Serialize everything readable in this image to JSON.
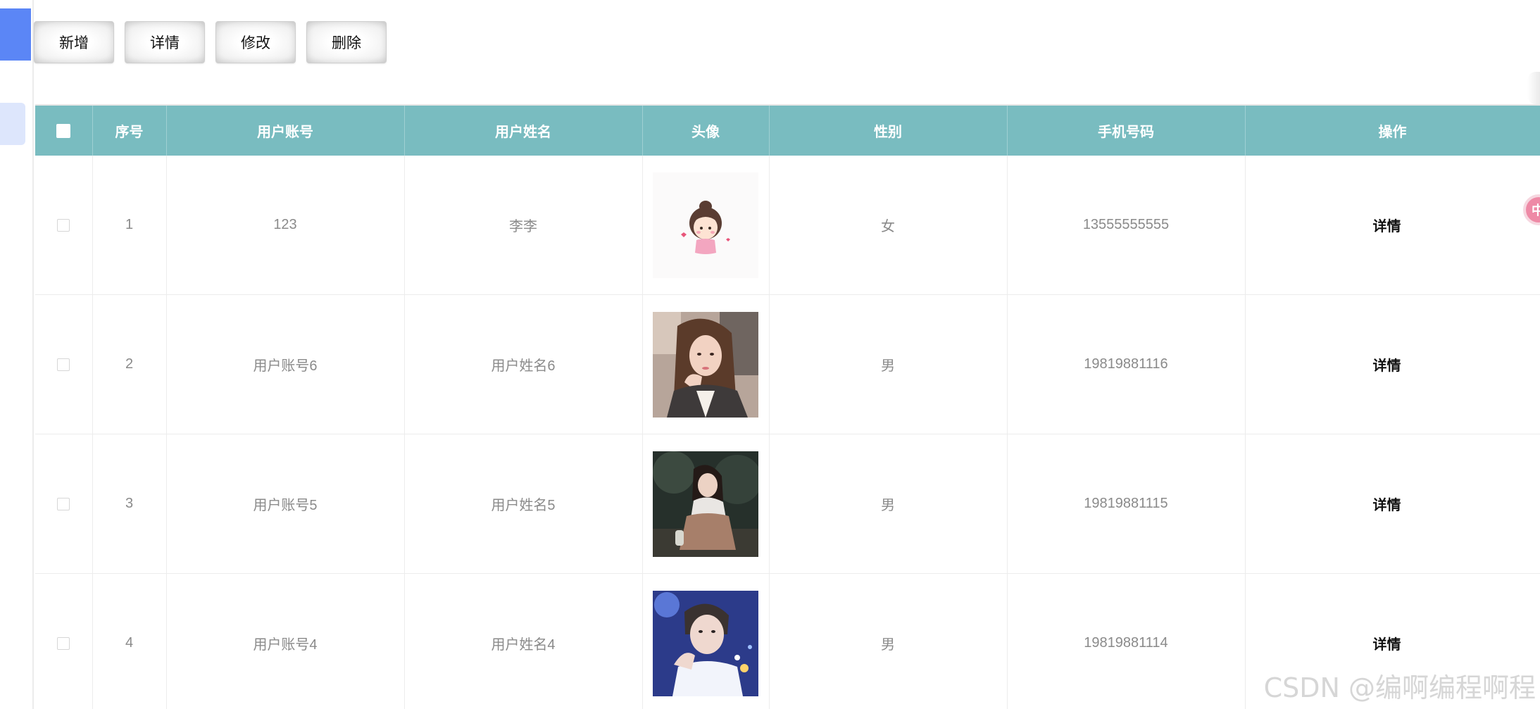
{
  "toolbar": {
    "add_label": "新增",
    "detail_label": "详情",
    "edit_label": "修改",
    "delete_label": "删除"
  },
  "table": {
    "columns": [
      "序号",
      "用户账号",
      "用户姓名",
      "头像",
      "性别",
      "手机号码",
      "操作"
    ],
    "rows": [
      {
        "index": "1",
        "account": "123",
        "name": "李李",
        "avatar": "cartoon-girl-avatar",
        "gender": "女",
        "phone": "13555555555",
        "action": "详情"
      },
      {
        "index": "2",
        "account": "用户账号6",
        "name": "用户姓名6",
        "avatar": "woman-portrait-avatar",
        "gender": "男",
        "phone": "19819881116",
        "action": "详情"
      },
      {
        "index": "3",
        "account": "用户账号5",
        "name": "用户姓名5",
        "avatar": "woman-sitting-avatar",
        "gender": "男",
        "phone": "19819881115",
        "action": "详情"
      },
      {
        "index": "4",
        "account": "用户账号4",
        "name": "用户姓名4",
        "avatar": "man-portrait-avatar",
        "gender": "男",
        "phone": "19819881114",
        "action": "详情"
      }
    ]
  },
  "float_widget": {
    "label": "中"
  },
  "watermark": "CSDN @编啊编程啊程",
  "colors": {
    "header_bg": "#79bcc0",
    "sidebar_active": "#5b86f6",
    "sidebar_hover": "#dde6fc"
  }
}
